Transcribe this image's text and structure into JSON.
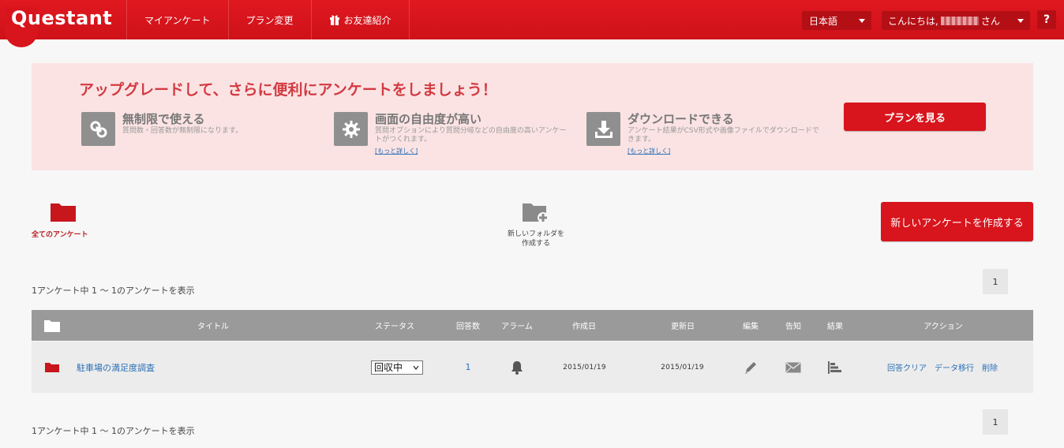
{
  "header": {
    "logo": "Questant",
    "nav": [
      "マイアンケート",
      "プラン変更",
      "お友達紹介"
    ],
    "language": "日本語",
    "greeting_prefix": "こんにちは,",
    "greeting_suffix": "さん",
    "help": "?"
  },
  "banner": {
    "title": "アップグレードして、さらに便利にアンケートをしましょう！",
    "features": [
      {
        "head": "無制限で使える",
        "desc": "質問数・回答数が無制限になります。",
        "link": ""
      },
      {
        "head": "画面の自由度が高い",
        "desc": "質問オプションにより質問分岐などの自由度の高いアンケートがつくれます。",
        "link": "[もっと詳しく]"
      },
      {
        "head": "ダウンロードできる",
        "desc": "アンケート結果がCSV形式や画像ファイルでダウンロードできます。",
        "link": "[もっと詳しく]"
      }
    ],
    "plan_button": "プランを見る"
  },
  "folders": {
    "all_label": "全てのアンケート",
    "new_folder_line1": "新しいフォルダを",
    "new_folder_line2": "作成する"
  },
  "create_button": "新しいアンケートを作成する",
  "count_text": "1アンケート中  1 〜 1のアンケートを表示",
  "page_number": "1",
  "table": {
    "headers": {
      "title": "タイトル",
      "status": "ステータス",
      "responses": "回答数",
      "alarm": "アラーム",
      "created": "作成日",
      "updated": "更新日",
      "edit": "編集",
      "notify": "告知",
      "results": "結果",
      "actions": "アクション"
    },
    "rows": [
      {
        "title": "駐車場の満足度調査",
        "status": "回収中",
        "responses": "1",
        "created": "2015/01/19",
        "updated": "2015/01/19",
        "actions": [
          "回答クリア",
          "データ移行",
          "削除"
        ]
      }
    ]
  },
  "colors": {
    "brand": "#d8141c",
    "banner_bg": "#fbe3e3",
    "link": "#2a6fb5"
  }
}
